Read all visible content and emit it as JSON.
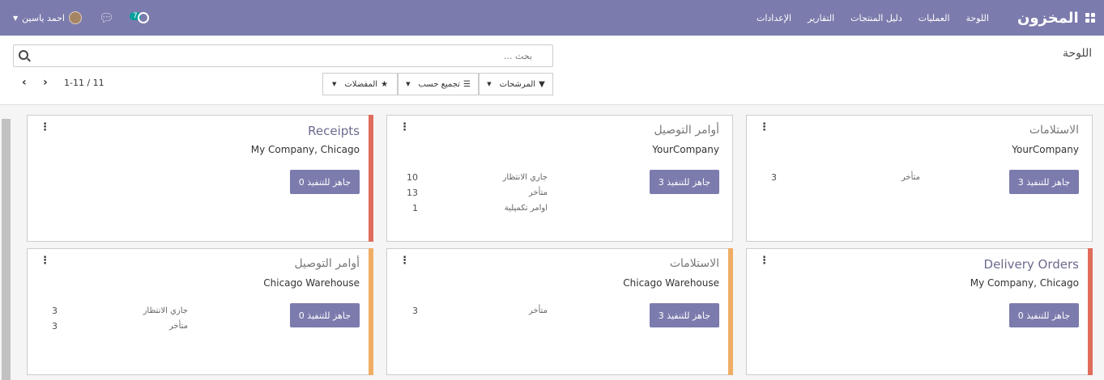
{
  "navbar": {
    "brand": "المخزون",
    "menu": [
      "اللوحة",
      "العمليات",
      "دليل المنتجات",
      "التقارير",
      "الإعدادات"
    ],
    "activity_count": "7",
    "user_name": "احمد ياسين",
    "colors": {
      "navbar": "#7c7bad",
      "badge": "#00a09d"
    }
  },
  "control_panel": {
    "title": "اللوحة",
    "search_placeholder": "بحث ...",
    "filters_label": "المرشحات",
    "groupby_label": "تجميع حسب",
    "favorites_label": "المفضلات",
    "pager_value": "1-11 / 11"
  },
  "cards": [
    {
      "title": "الاستلامات",
      "company": "YourCompany",
      "action": "3 جاهز للتنفيذ",
      "stats": [
        {
          "label": "متأخر",
          "value": "3"
        }
      ],
      "stripe_color": ""
    },
    {
      "title": "أوامر التوصيل",
      "company": "YourCompany",
      "action": "3 جاهز للتنفيذ",
      "stats": [
        {
          "label": "جاري الانتظار",
          "value": "10"
        },
        {
          "label": "متأخر",
          "value": "13"
        },
        {
          "label": "اوامر تكميلية",
          "value": "1"
        }
      ],
      "stripe_color": ""
    },
    {
      "title": "Receipts",
      "company": "My Company, Chicago",
      "action": "0 جاهز للتنفيذ",
      "stats": [],
      "stripe_color": "#e06c5c"
    },
    {
      "title": "Delivery Orders",
      "company": "My Company, Chicago",
      "action": "0 جاهز للتنفيذ",
      "stats": [],
      "stripe_color": "#e06c5c"
    },
    {
      "title": "الاستلامات",
      "company": "Chicago Warehouse",
      "action": "3 جاهز للتنفيذ",
      "stats": [
        {
          "label": "متأخر",
          "value": "3"
        }
      ],
      "stripe_color": "#f0ad66"
    },
    {
      "title": "أوامر التوصيل",
      "company": "Chicago Warehouse",
      "action": "0 جاهز للتنفيذ",
      "stats": [
        {
          "label": "جاري الانتظار",
          "value": "3"
        },
        {
          "label": "متأخر",
          "value": "3"
        }
      ],
      "stripe_color": "#f0ad66"
    }
  ]
}
